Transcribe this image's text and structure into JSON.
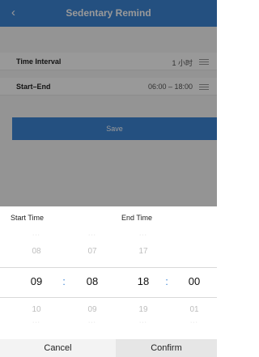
{
  "header": {
    "back_icon": "‹",
    "title": "Sedentary Remind"
  },
  "rows": [
    {
      "label": "Time Interval",
      "value": "1 小时"
    },
    {
      "label": "Start–End",
      "value": "06:00 – 18:00"
    }
  ],
  "save_label": "Save",
  "picker": {
    "start_label": "Start Time",
    "end_label": "End Time",
    "separator": ":",
    "dots": "···",
    "start_hour": {
      "prev": "08",
      "selected": "09",
      "next": "10"
    },
    "start_minute": {
      "prev": "07",
      "selected": "08",
      "next": "09"
    },
    "end_hour": {
      "prev": "17",
      "selected": "18",
      "next": "19"
    },
    "end_minute": {
      "prev": "",
      "selected": "00",
      "next": "01"
    }
  },
  "buttons": {
    "cancel": "Cancel",
    "confirm": "Confirm"
  },
  "colors": {
    "accent": "#3d85d6",
    "overlay": "rgba(0,0,0,0.40)"
  }
}
